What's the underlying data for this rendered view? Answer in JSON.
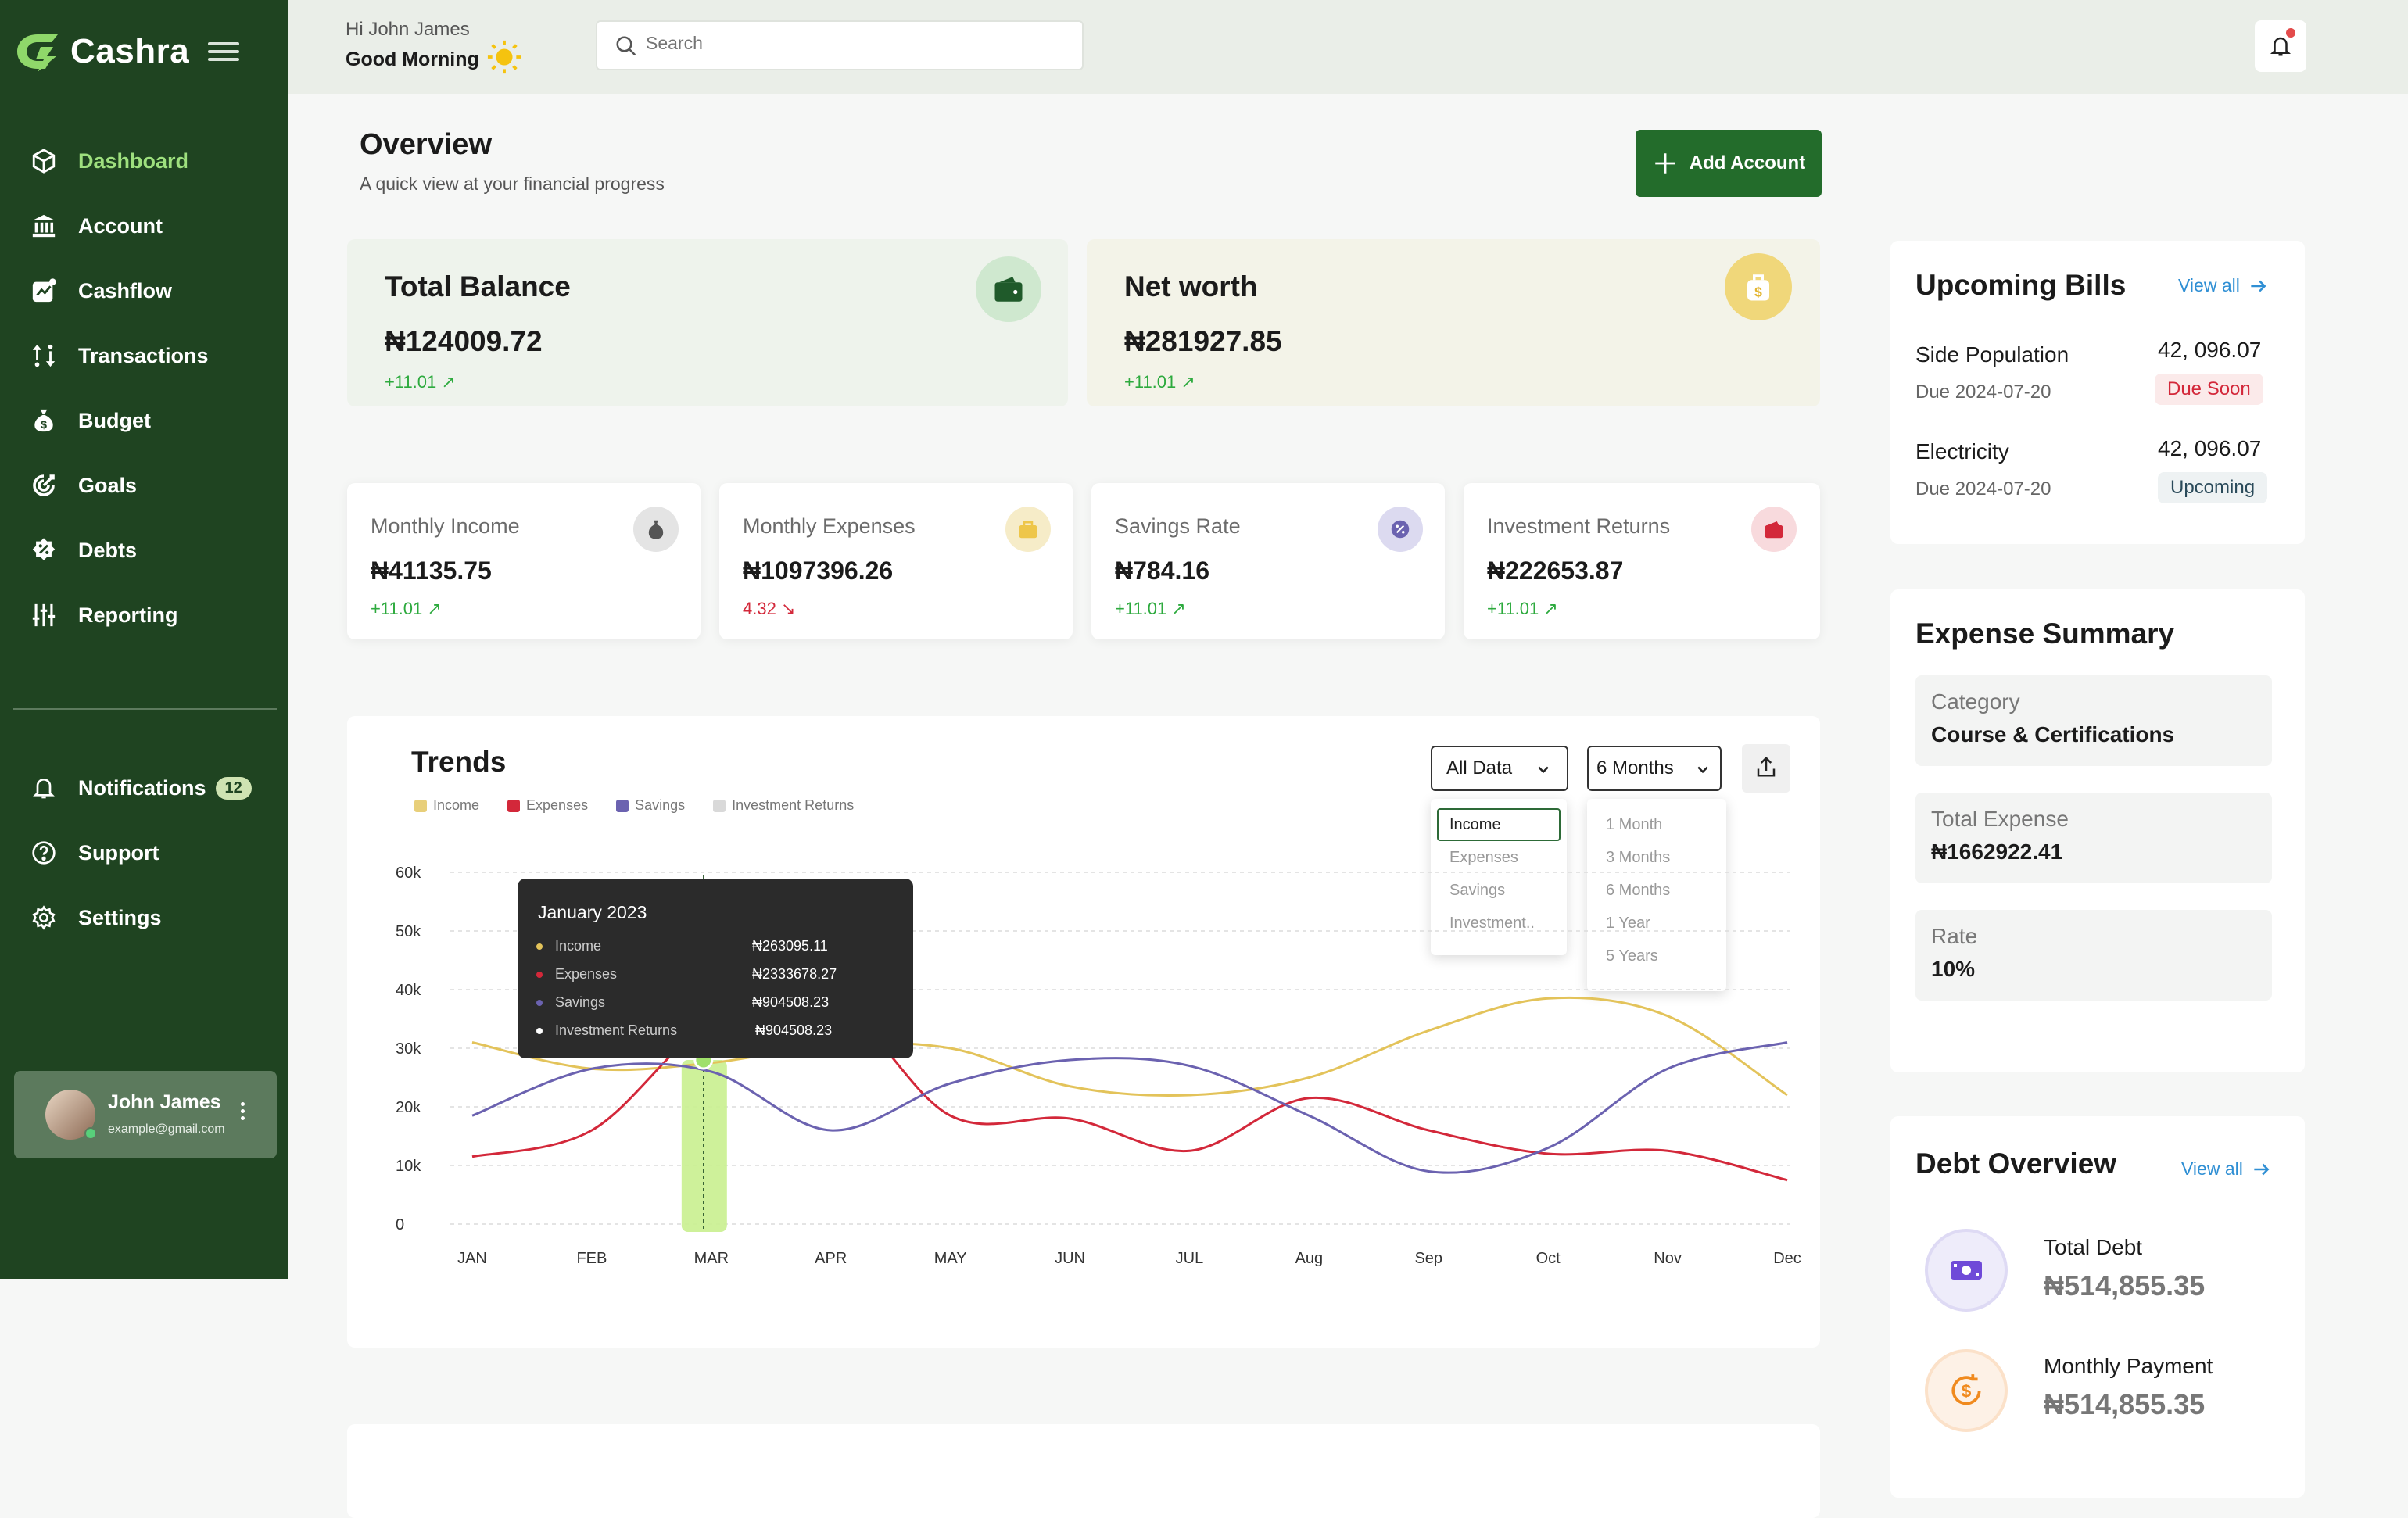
{
  "brand": {
    "name": "Cashra"
  },
  "nav": {
    "items": [
      {
        "label": "Dashboard",
        "icon": "cube-icon",
        "active": true
      },
      {
        "label": "Account",
        "icon": "bank-icon"
      },
      {
        "label": "Cashflow",
        "icon": "chart-icon"
      },
      {
        "label": "Transactions",
        "icon": "transfer-icon"
      },
      {
        "label": "Budget",
        "icon": "money-bag-icon"
      },
      {
        "label": "Goals",
        "icon": "target-icon"
      },
      {
        "label": "Debts",
        "icon": "percent-badge-icon"
      },
      {
        "label": "Reporting",
        "icon": "sliders-icon"
      }
    ],
    "bottom": [
      {
        "label": "Notifications",
        "icon": "bell-icon",
        "badge": "12"
      },
      {
        "label": "Support",
        "icon": "help-icon"
      },
      {
        "label": "Settings",
        "icon": "gear-icon"
      }
    ]
  },
  "user": {
    "name": "John James",
    "email": "example@gmail.com"
  },
  "header": {
    "greeting": "Hi John James",
    "salutation": "Good Morning",
    "search_placeholder": "Search"
  },
  "overview": {
    "title": "Overview",
    "subtitle": "A quick view at your financial progress",
    "add_label": "Add Account"
  },
  "balance_cards": [
    {
      "label": "Total Balance",
      "value": "₦124009.72",
      "change": "+11.01"
    },
    {
      "label": "Net worth",
      "value": "₦281927.85",
      "change": "+11.01"
    }
  ],
  "stat_cards": [
    {
      "label": "Monthly Income",
      "value": "₦41135.75",
      "change": "+11.01",
      "direction": "up"
    },
    {
      "label": "Monthly Expenses",
      "value": "₦1097396.26",
      "change": "4.32",
      "direction": "down"
    },
    {
      "label": "Savings Rate",
      "value": "₦784.16",
      "change": "+11.01",
      "direction": "up"
    },
    {
      "label": "Investment Returns",
      "value": "₦222653.87",
      "change": "+11.01",
      "direction": "up"
    }
  ],
  "trends": {
    "title": "Trends",
    "filter_data": "All Data",
    "filter_period": "6 Months",
    "data_options": [
      "Income",
      "Expenses",
      "Savings",
      "Investment.."
    ],
    "period_options": [
      "1 Month",
      "3 Months",
      "6 Months",
      "1 Year",
      "5 Years"
    ],
    "tooltip": {
      "title": "January 2023",
      "rows": [
        {
          "label": "Income",
          "value": "₦263095.11",
          "color": "#e3c35a"
        },
        {
          "label": "Expenses",
          "value": "₦2333678.27",
          "color": "#d3283a"
        },
        {
          "label": "Savings",
          "value": "₦904508.23",
          "color": "#6b62b0"
        },
        {
          "label": "Investment Returns",
          "value": "₦904508.23",
          "color": "#ffffff"
        }
      ]
    }
  },
  "chart_data": {
    "type": "line",
    "title": "Trends",
    "categories": [
      "JAN",
      "FEB",
      "MAR",
      "APR",
      "MAY",
      "JUN",
      "JUL",
      "Aug",
      "Sep",
      "Oct",
      "Nov",
      "Dec"
    ],
    "y_ticks": [
      "0",
      "10k",
      "20k",
      "30k",
      "40k",
      "50k",
      "60k"
    ],
    "ylim": [
      0,
      60000
    ],
    "highlight_category": "MAR",
    "series": [
      {
        "name": "Income",
        "color": "#e3c35a",
        "values": [
          31000,
          26500,
          27500,
          30500,
          30000,
          23500,
          22000,
          25000,
          33000,
          38500,
          35500,
          22000
        ]
      },
      {
        "name": "Expenses",
        "color": "#d3283a",
        "values": [
          11500,
          16000,
          34500,
          38500,
          18500,
          18000,
          12500,
          21500,
          16000,
          12000,
          12500,
          7500
        ]
      },
      {
        "name": "Savings",
        "color": "#6b62b0",
        "values": [
          18500,
          26500,
          26000,
          16000,
          24000,
          28000,
          27000,
          18500,
          9000,
          13000,
          26500,
          31000
        ]
      },
      {
        "name": "Investment Returns",
        "color": "#d9d9d9",
        "values": []
      }
    ],
    "legend_position": "top-left",
    "grid": true
  },
  "bills": {
    "title": "Upcoming Bills",
    "view_all": "View all",
    "items": [
      {
        "name": "Side Population",
        "due": "Due 2024-07-20",
        "amount": "42, 096.07",
        "status": "Due Soon",
        "status_color": "#d3283a"
      },
      {
        "name": "Electricity",
        "due": "Due 2024-07-20",
        "amount": "42, 096.07",
        "status": "Upcoming",
        "status_color": "#2a4a5a"
      }
    ]
  },
  "expense_summary": {
    "title": "Expense Summary",
    "rows": [
      {
        "key": "Category",
        "value": "Course & Certifications"
      },
      {
        "key": "Total Expense",
        "value": "₦1662922.41"
      },
      {
        "key": "Rate",
        "value": "10%"
      }
    ]
  },
  "debt_overview": {
    "title": "Debt Overview",
    "view_all": "View all",
    "items": [
      {
        "label": "Total Debt",
        "value": "₦514,855.35",
        "icon": "cash-icon"
      },
      {
        "label": "Monthly Payment",
        "value": "₦514,855.35",
        "icon": "dollar-refresh-icon"
      }
    ]
  }
}
